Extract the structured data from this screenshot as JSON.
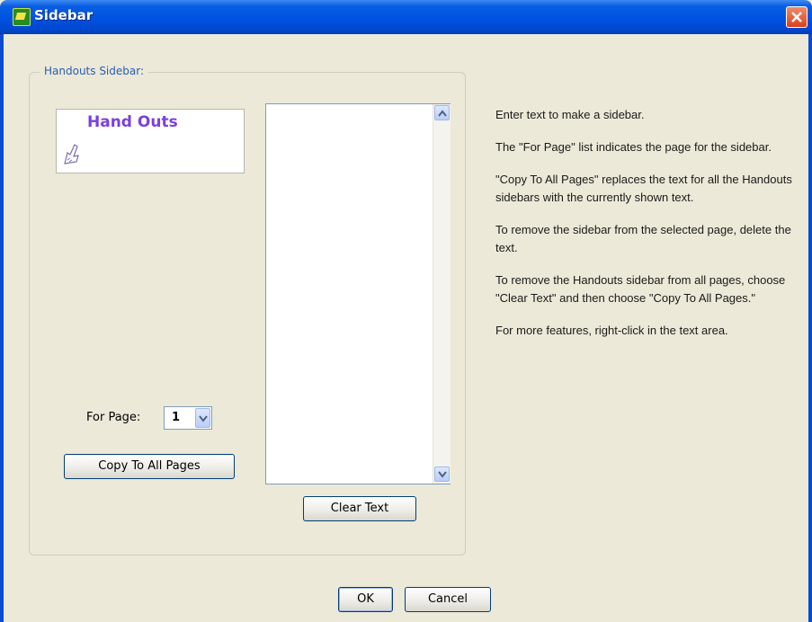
{
  "window": {
    "title": "Sidebar",
    "icon": "app-icon",
    "close_icon": "close-icon"
  },
  "group": {
    "legend": "Handouts Sidebar:"
  },
  "preview": {
    "title": "Hand Outs",
    "icon": "hand-pointer-icon"
  },
  "text_area": {
    "value": ""
  },
  "for_page": {
    "label": "For Page:",
    "value": "1"
  },
  "buttons": {
    "copy_to_all_pages": "Copy To All Pages",
    "clear_text": "Clear Text",
    "ok": "OK",
    "cancel": "Cancel"
  },
  "help": {
    "paragraphs": [
      "Enter text to make a sidebar.",
      "The \"For Page\" list indicates the page for the sidebar.",
      "\"Copy To All Pages\" replaces the text for all the Handouts sidebars with the currently shown text.",
      "To remove the sidebar from the selected page, delete the text.",
      "To remove the Handouts sidebar from all pages, choose \"Clear Text\" and then choose \"Copy To All Pages.\"",
      "For more features, right-click in the text area."
    ]
  },
  "colors": {
    "titlebar": "#0054e3",
    "dialog_bg": "#ece9d8",
    "legend_text": "#2a5db0",
    "preview_title": "#7a3fe0"
  }
}
